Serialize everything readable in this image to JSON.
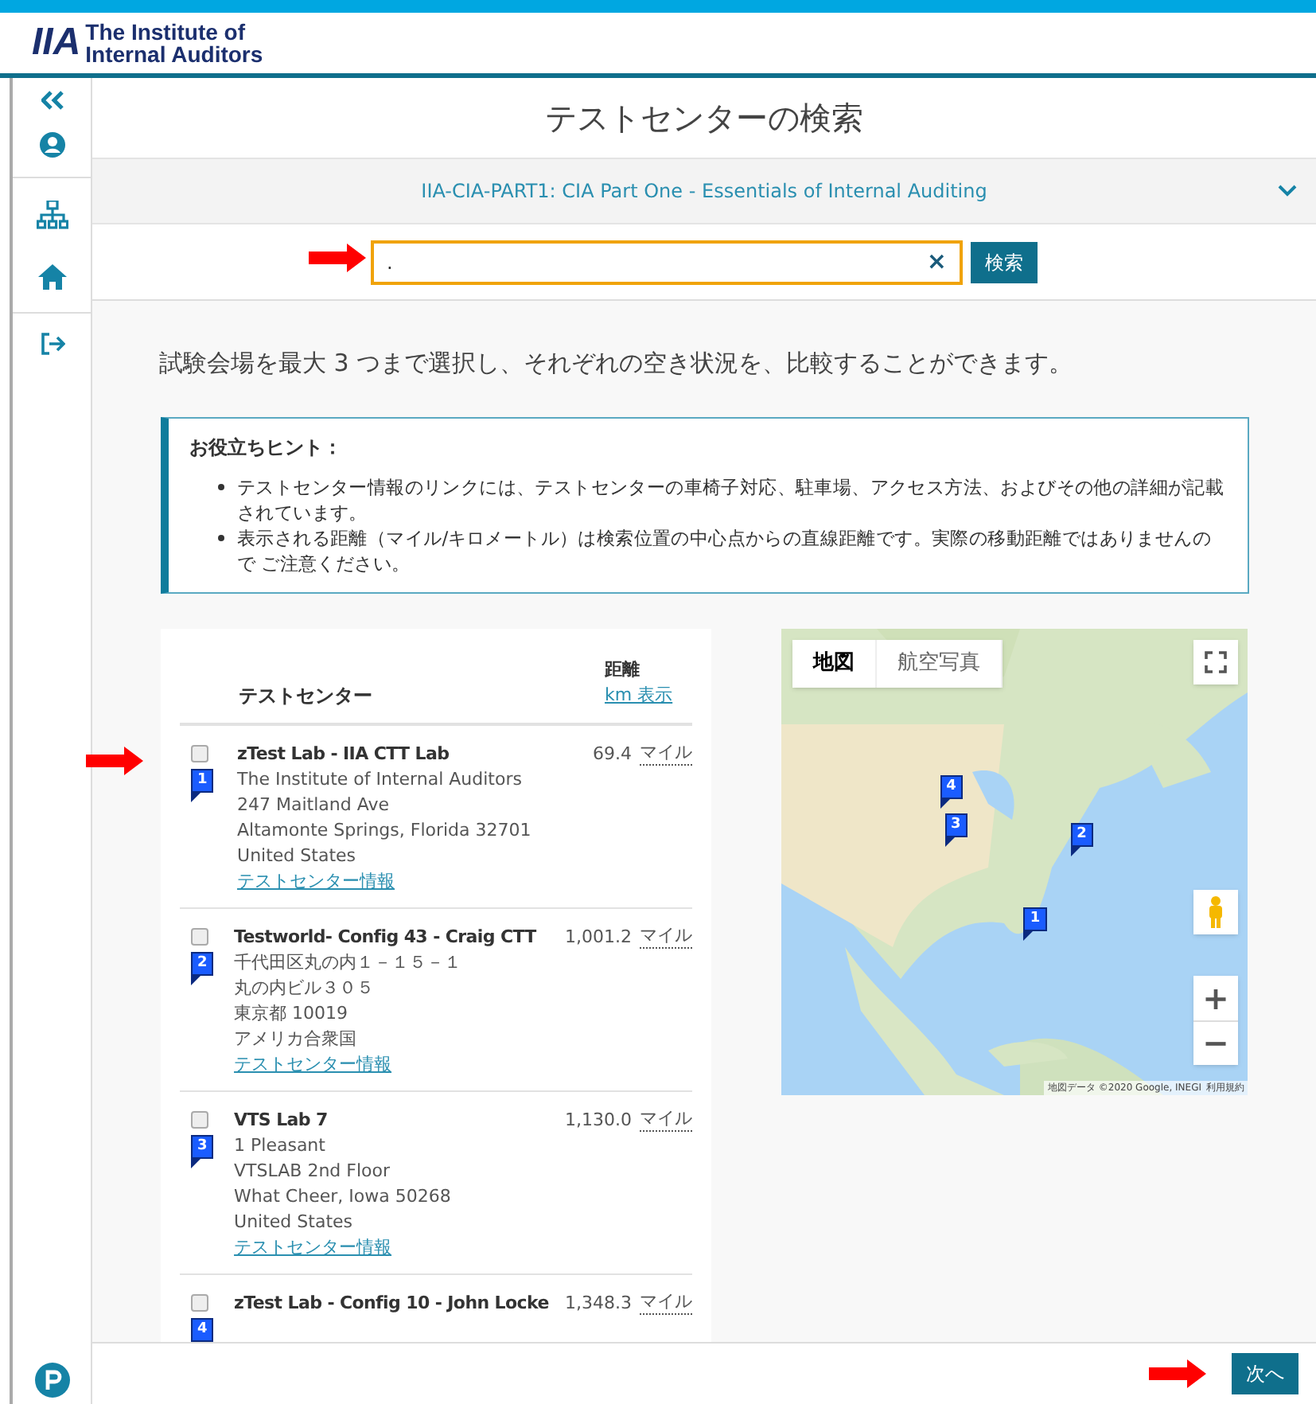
{
  "header": {
    "logo_mark": "IIA",
    "logo_line1": "The Institute of",
    "logo_line2": "Internal Auditors"
  },
  "page_title": "テストセンターの検索",
  "exam": {
    "label": "IIA-CIA-PART1: CIA Part One - Essentials of Internal Auditing",
    "expanded": false
  },
  "search": {
    "value": ".",
    "clear": "×",
    "button": "検索"
  },
  "intro": "試験会場を最大 3 つまで選択し、それぞれの空き状況を、比較することができます。",
  "hint": {
    "title": "お役立ちヒント：",
    "items": [
      "テストセンター情報のリンクには、テストセンターの車椅子対応、駐車場、アクセス方法、およびその他の詳細が記載されています。",
      "表示される距離（マイル/キロメートル）は検索位置の中心点からの直線距離です。実際の移動距離ではありませんので ご注意ください。"
    ]
  },
  "table": {
    "col_center": "テストセンター",
    "col_distance": "距離",
    "km_toggle": "km 表示",
    "rows": [
      {
        "checked": false,
        "marker": "1",
        "name": "zTest Lab - IIA CTT Lab",
        "address": [
          "The Institute of Internal Auditors",
          "247 Maitland Ave",
          "Altamonte Springs, Florida 32701",
          "United States"
        ],
        "link": "テストセンター情報",
        "distance": "69.4",
        "unit": "マイル"
      },
      {
        "checked": false,
        "marker": "2",
        "name": "Testworld- Config 43 - Craig CTT",
        "address": [
          "千代田区丸の内１－１５－１",
          "丸の内ビル３０５",
          "東京都 10019",
          "アメリカ合衆国"
        ],
        "link": "テストセンター情報",
        "distance": "1,001.2",
        "unit": "マイル"
      },
      {
        "checked": false,
        "marker": "3",
        "name": "VTS Lab 7",
        "address": [
          "1 Pleasant",
          "VTSLAB 2nd Floor",
          "What Cheer, Iowa 50268",
          "United States"
        ],
        "link": "テストセンター情報",
        "distance": "1,130.0",
        "unit": "マイル"
      },
      {
        "checked": false,
        "marker": "4",
        "name": "zTest Lab - Config 10 - John Locke",
        "address": [],
        "link": "",
        "distance": "1,348.3",
        "unit": "マイル"
      }
    ]
  },
  "map": {
    "types": [
      {
        "label": "地図",
        "selected": true
      },
      {
        "label": "航空写真",
        "selected": false
      }
    ],
    "zoom_in": "+",
    "zoom_out": "−",
    "attribution": "地図データ ©2020 Google, INEGI",
    "terms": "利用規約",
    "pins": [
      {
        "label": "1"
      },
      {
        "label": "2"
      },
      {
        "label": "3"
      },
      {
        "label": "4"
      }
    ]
  },
  "next_button": "次へ"
}
